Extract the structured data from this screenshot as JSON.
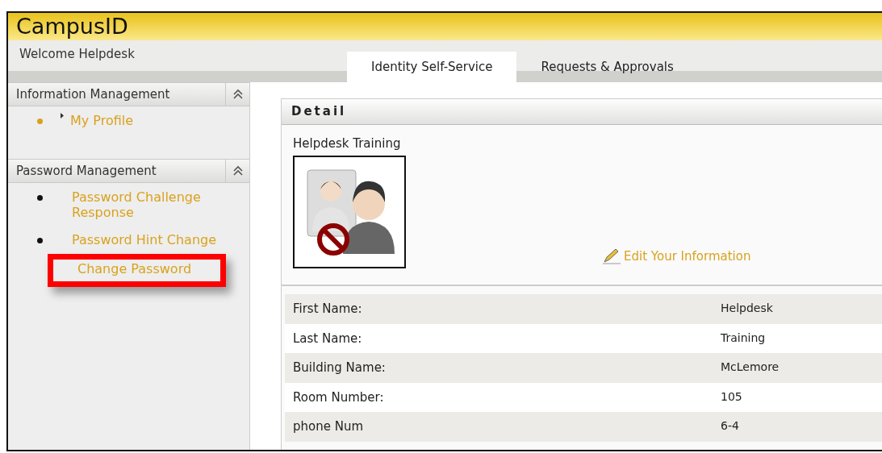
{
  "app_title": "CampusID",
  "welcome": "Welcome Helpdesk",
  "tabs": [
    {
      "label": "Identity Self-Service",
      "selected": true
    },
    {
      "label": "Requests & Approvals",
      "selected": false
    }
  ],
  "sidebar": {
    "sections": [
      {
        "title": "Information Management",
        "expanded": true,
        "items": [
          {
            "label": "My Profile",
            "bullet": true,
            "current": true,
            "highlighted": false
          }
        ]
      },
      {
        "title": "Password Management",
        "expanded": true,
        "items": [
          {
            "label": "Password Challenge Response",
            "bullet": true,
            "current": false,
            "highlighted": false
          },
          {
            "label": "Password Hint Change",
            "bullet": true,
            "current": false,
            "highlighted": false
          },
          {
            "label": "Change Password",
            "bullet": false,
            "current": false,
            "highlighted": true
          }
        ]
      }
    ]
  },
  "detail": {
    "title": "Detail",
    "name": "Helpdesk Training",
    "edit_link": "Edit Your Information",
    "rows": [
      {
        "label": "First Name:",
        "value": "Helpdesk"
      },
      {
        "label": "Last Name:",
        "value": "Training"
      },
      {
        "label": "Building Name:",
        "value": "McLemore"
      },
      {
        "label": "Room Number:",
        "value": "105"
      },
      {
        "label": "phone Num",
        "value": "6-4"
      }
    ]
  }
}
